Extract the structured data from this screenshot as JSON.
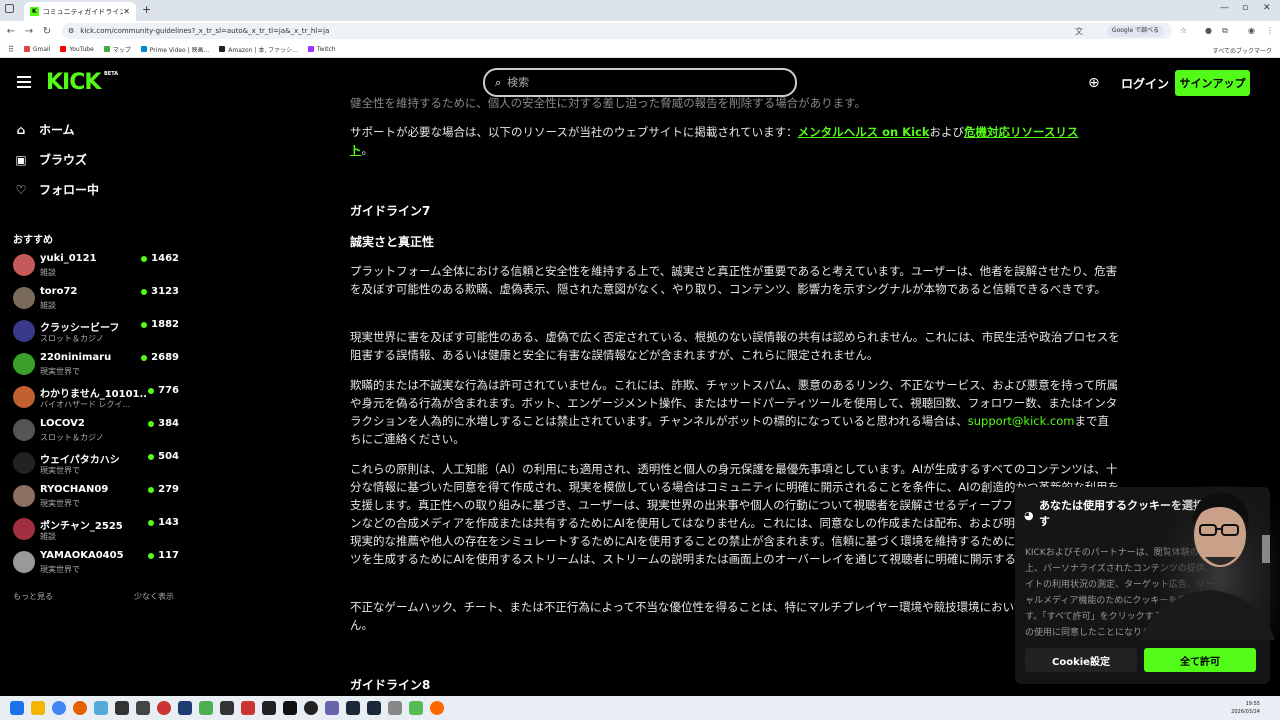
{
  "browser": {
    "tab_title": "コミュニティガイドライン - キックストリ",
    "tab_fav": "K",
    "url": "kick.com/community-guidelines?_x_tr_sl=auto&_x_tr_tl=ja&_x_tr_hl=ja",
    "google_translate_label": "Google で調べる",
    "bookmarks": [
      "Gmail",
      "YouTube",
      "マップ",
      "Prime Video | 映画...",
      "Amazon | 本, ファッシ...",
      "Twitch"
    ],
    "bookmarks_right": "すべてのブックマーク",
    "clock_time": "19:55",
    "clock_date": "2026/03/24"
  },
  "header": {
    "logo": "KICK",
    "beta": "BETA",
    "search_placeholder": "検索",
    "login_label": "ログイン",
    "signup_label": "サインアップ"
  },
  "sidebar": {
    "nav": [
      {
        "label": "ホーム",
        "icon": "home-icon"
      },
      {
        "label": "ブラウズ",
        "icon": "browse-icon"
      },
      {
        "label": "フォロー中",
        "icon": "heart-icon"
      }
    ],
    "recommended_title": "おすすめ",
    "channels": [
      {
        "name": "yuki_0121",
        "category": "雑談",
        "viewers": "1462",
        "color": "#c45a5a"
      },
      {
        "name": "toro72",
        "category": "雑談",
        "viewers": "3123",
        "color": "#7a6a5a"
      },
      {
        "name": "クラッシービーフ",
        "category": "スロット＆カジノ",
        "viewers": "1882",
        "color": "#3a3a8a"
      },
      {
        "name": "220ninimaru",
        "category": "現実世界で",
        "viewers": "2689",
        "color": "#3aa02a"
      },
      {
        "name": "わかりません_10101...",
        "category": "バイオハザード レクイ...",
        "viewers": "776",
        "color": "#c06030"
      },
      {
        "name": "LOCOV2",
        "category": "スロット＆カジノ",
        "viewers": "384",
        "color": "#555"
      },
      {
        "name": "ウェイパタカハシ",
        "category": "現実世界で",
        "viewers": "504",
        "color": "#222"
      },
      {
        "name": "RYOCHAN09",
        "category": "現実世界で",
        "viewers": "279",
        "color": "#8a7060"
      },
      {
        "name": "ポンチャン_2525",
        "category": "雑談",
        "viewers": "143",
        "color": "#a03040"
      },
      {
        "name": "YAMAOKA0405",
        "category": "現実世界で",
        "viewers": "117",
        "color": "#999"
      }
    ],
    "show_more": "もっと見る",
    "show_less": "少なく表示"
  },
  "content": {
    "cut_line": "健全性を維持するために、個人の安全性に対する差し迫った脅威の報告を削除する場合があります。",
    "support_text": "サポートが必要な場合は、以下のリソースが当社のウェブサイトに掲載されています：",
    "support_link1": "メンタルヘルス on Kick",
    "support_and": "および",
    "support_link2a": "危機対応リソースリス",
    "support_link2b": "ト",
    "support_end": "。",
    "guideline7_title": "ガイドライン7",
    "guideline7_subtitle": "誠実さと真正性",
    "p1": "プラットフォーム全体における信頼と安全性を維持する上で、誠実さと真正性が重要であると考えています。ユーザーは、他者を誤解させたり、危害を及ぼす可能性のある欺瞞、虚偽表示、隠された意図がなく、やり取り、コンテンツ、影響力を示すシグナルが本物であると信頼できるべきです。",
    "p2": "現実世界に害を及ぼす可能性のある、虚偽で広く否定されている、根拠のない誤情報の共有は認められません。これには、市民生活や政治プロセスを阻害する誤情報、あるいは健康と安全に有害な誤情報などが含まれますが、これらに限定されません。",
    "p3": "欺瞞的または不誠実な行為は許可されていません。これには、詐欺、チャットスパム、悪意のあるリンク、不正なサービス、および悪意を持って所属や身元を偽る行為が含まれます。ボット、エンゲージメント操作、またはサードパーティツールを使用して、視聴回数、フォロワー数、またはインタラクションを人為的に水増しすることは禁止されています。チャンネルがボットの標的になっていると思われる場合は、",
    "p3_email": "support@kick.com",
    "p3_end": "まで直ちにご連絡ください。",
    "p4": "これらの原則は、人工知能（AI）の利用にも適用され、透明性と個人の身元保護を最優先事項としています。AIが生成するすべてのコンテンツは、十分な情報に基づいた同意を得て作成され、現実を模倣している場合はコミュニティに明確に開示されることを条件に、AIの創造的かつ革新的な利用を支援します。真正性への取り組みに基づき、ユーザーは、現実世界の出来事や個人の行動について視聴者を誤解させるディープフェイクや音声クローンなどの合成メディアを作成または共有するためにAIを使用してはなりません。これには、同意なしの作成または配布、および明示的な許可なしに、現実的な推薦や他人の存在をシミュレートするためにAIを使用することの禁止が含まれます。信頼に基づく環境を維持するために、現実的なコンテンツを生成するためにAIを使用するストリームは、ストリームの説明または画面上のオーバーレイを通じて視聴者に明確に開示する必要があります。",
    "p5": "不正なゲームハック、チート、または不正行為によって不当な優位性を得ることは、特にマルチプレイヤー環境や競技環境においては認められません。",
    "guideline8_title": "ガイドライン8"
  },
  "cookie": {
    "title": "あなたは使用するクッキーを選択できます",
    "body": "KICKおよびそのパートナーは、閲覧体験の向上、パーソナライズされたコンテンツの提供、サイトの利用状況の測定、ターゲット広告、ソーシャルメディア機能のためにクッキーを使用します。「すべて許可」をクリックすると、クッキーの使用に同意したことになります。",
    "settings_label": "Cookie設定",
    "allow_all_label": "全て許可"
  }
}
